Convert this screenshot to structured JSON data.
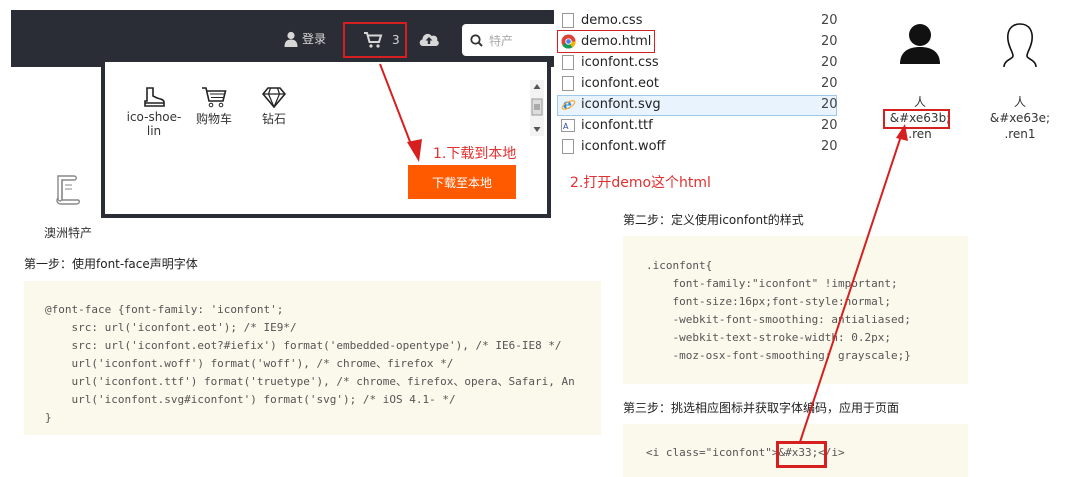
{
  "topbar": {
    "login_label": "登录",
    "cart_count": "3",
    "search_placeholder": "特产"
  },
  "panel": {
    "icons": [
      {
        "label": "ico-shoe-lin",
        "icon": "shoe-icon"
      },
      {
        "label": "购物车",
        "icon": "cart-icon"
      },
      {
        "label": "钻石",
        "icon": "diamond-icon"
      }
    ],
    "download_button": "下载至本地",
    "annotation_step1": "1.下载到本地"
  },
  "side_item": {
    "label": "澳洲特产",
    "icon": "parchment-icon"
  },
  "files": [
    {
      "name": "demo.css",
      "date": "20",
      "icon": "css-file-icon"
    },
    {
      "name": "demo.html",
      "date": "20",
      "icon": "chrome-icon"
    },
    {
      "name": "iconfont.css",
      "date": "20",
      "icon": "css-file-icon"
    },
    {
      "name": "iconfont.eot",
      "date": "20",
      "icon": "file-icon"
    },
    {
      "name": "iconfont.svg",
      "date": "20",
      "icon": "ie-icon"
    },
    {
      "name": "iconfont.ttf",
      "date": "20",
      "icon": "font-file-icon"
    },
    {
      "name": "iconfont.woff",
      "date": "20",
      "icon": "file-icon"
    }
  ],
  "annotation_step2": "2.打开demo这个html",
  "right_icons": [
    {
      "name": "人",
      "code": "&#xe63b;",
      "class": ".ren",
      "icon": "person-filled-icon"
    },
    {
      "name": "人",
      "code": "&#xe63e;",
      "class": ".ren1",
      "icon": "person-outline-icon"
    }
  ],
  "steps": {
    "step1_title": "第一步：使用font-face声明字体",
    "step1_code": "@font-face {font-family: 'iconfont';\n    src: url('iconfont.eot'); /* IE9*/\n    src: url('iconfont.eot?#iefix') format('embedded-opentype'), /* IE6-IE8 */\n    url('iconfont.woff') format('woff'), /* chrome、firefox */\n    url('iconfont.ttf') format('truetype'), /* chrome、firefox、opera、Safari, An\n    url('iconfont.svg#iconfont') format('svg'); /* iOS 4.1- */\n}",
    "step2_title": "第二步：定义使用iconfont的样式",
    "step2_code": ".iconfont{\n    font-family:\"iconfont\" !important;\n    font-size:16px;font-style:normal;\n    -webkit-font-smoothing: antialiased;\n    -webkit-text-stroke-width: 0.2px;\n    -moz-osx-font-smoothing: grayscale;}",
    "step3_title": "第三步：挑选相应图标并获取字体编码，应用于页面",
    "step3_code": "<i class=\"iconfont\">&#x33;</i>"
  },
  "colors": {
    "accent_orange": "#ff5a00",
    "annotation_red": "#e03030",
    "topbar_bg": "#2b2d36",
    "code_bg": "#fbf8ec"
  }
}
